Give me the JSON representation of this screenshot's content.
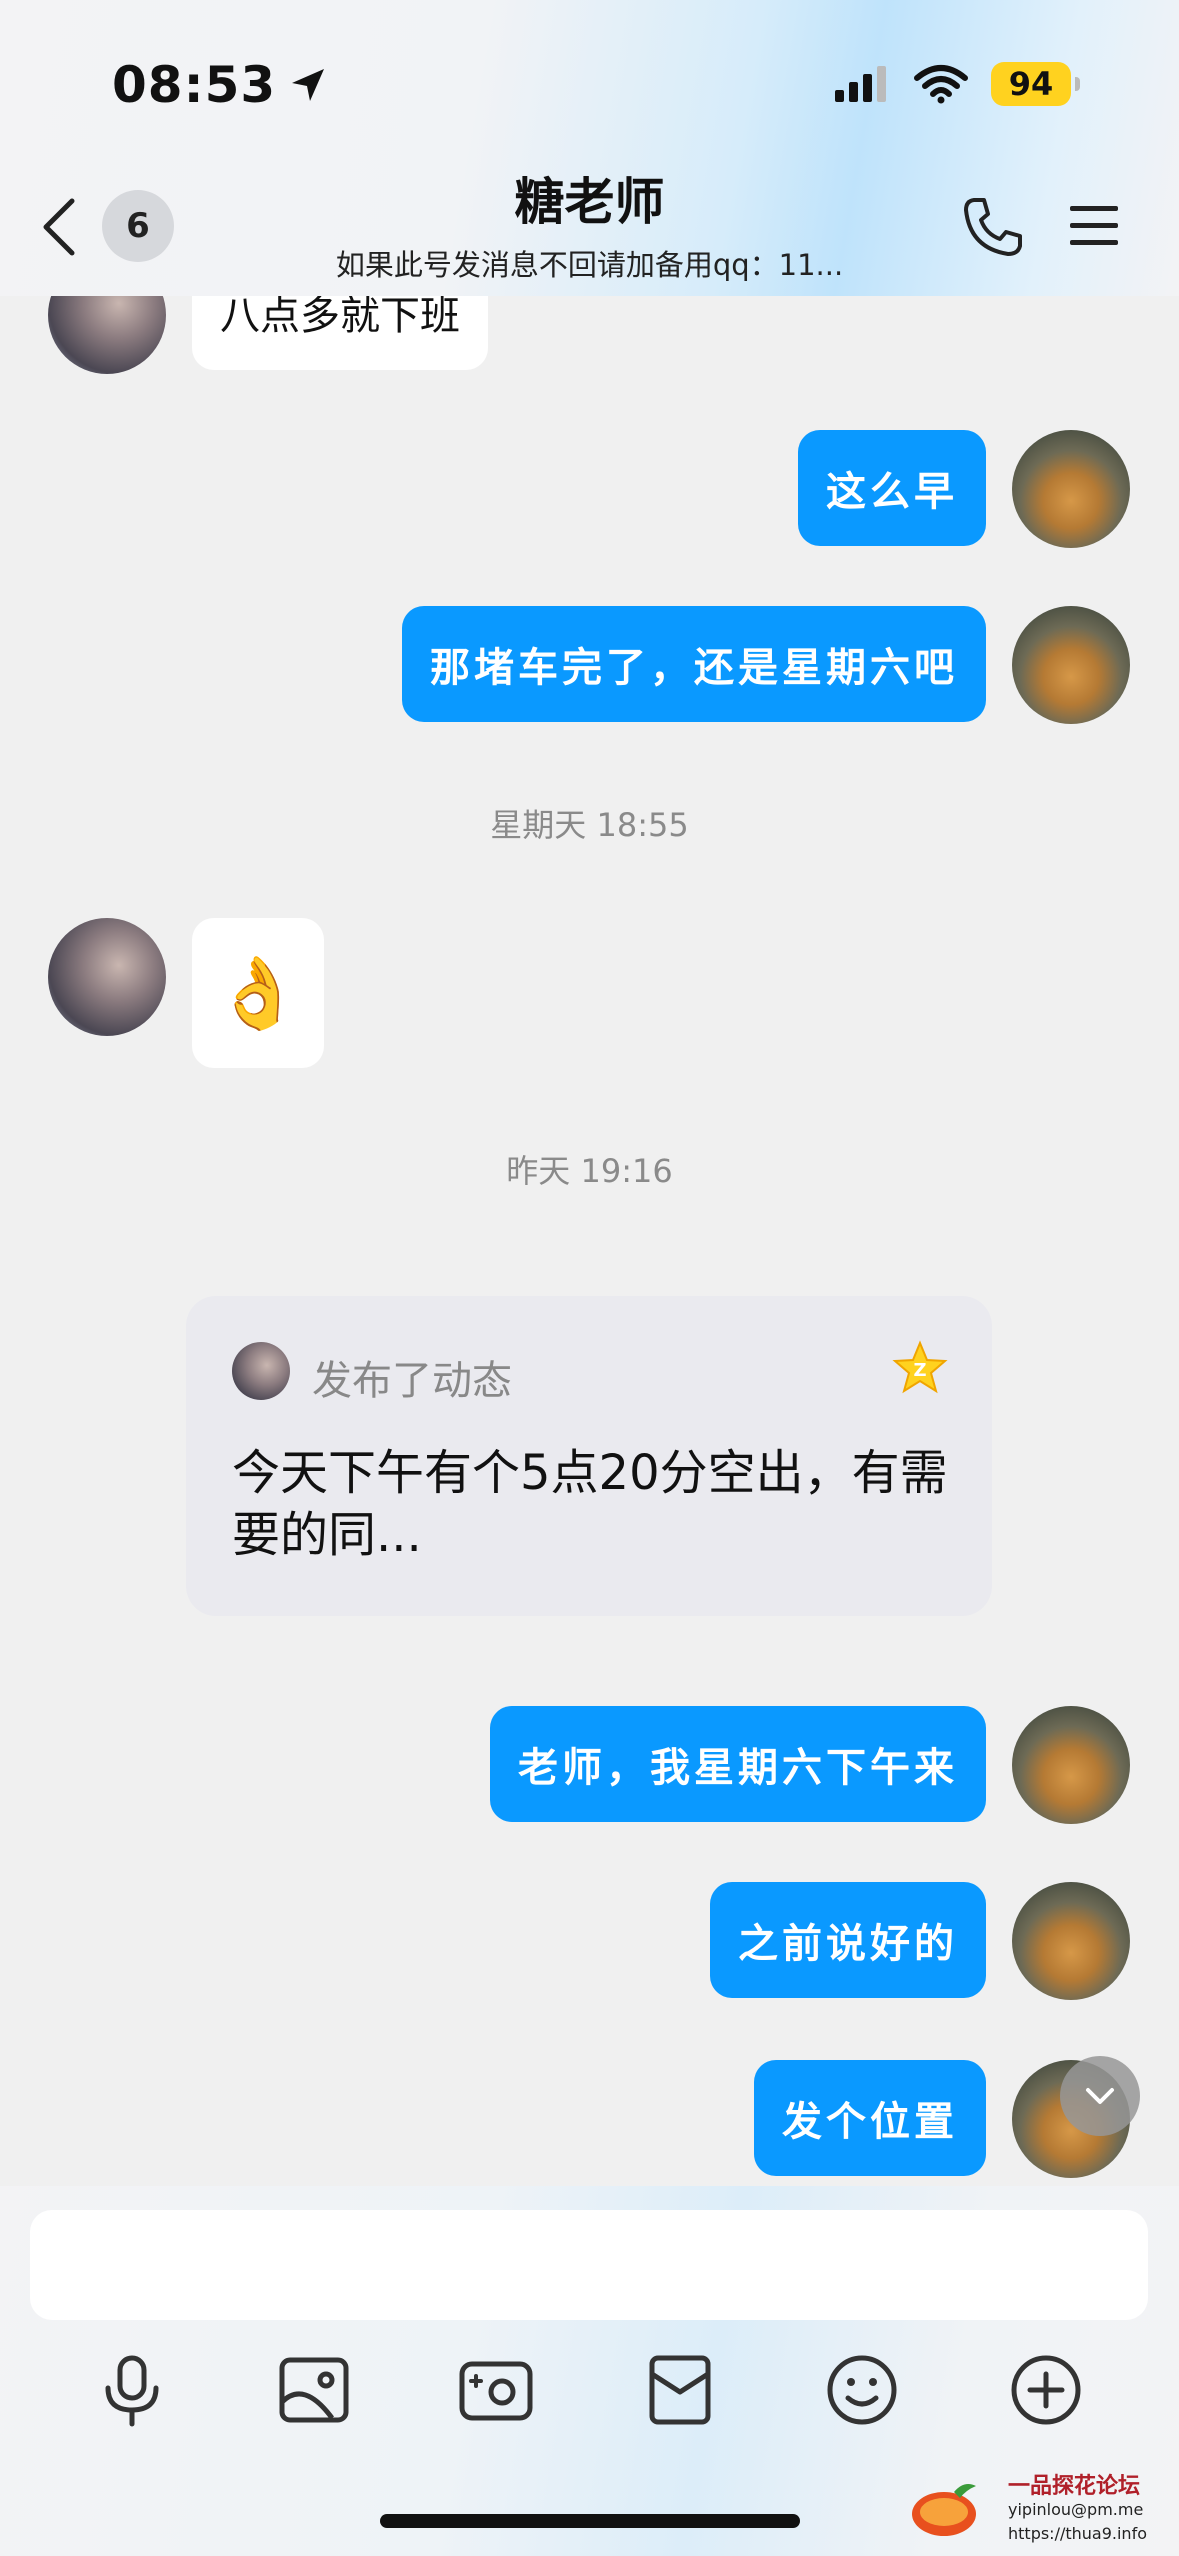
{
  "status_bar": {
    "time": "08:53",
    "battery": "94"
  },
  "header": {
    "unread_count": "6",
    "title": "糖老师",
    "subtitle": "如果此号发消息不回请加备用qq：11..."
  },
  "messages": [
    {
      "side": "in",
      "text": "八点多就下班"
    },
    {
      "side": "out",
      "text": "这么早"
    },
    {
      "side": "out",
      "text": "那堵车完了，还是星期六吧"
    },
    {
      "timestamp": "星期天 18:55"
    },
    {
      "side": "in",
      "emoji": "👌"
    },
    {
      "timestamp": "昨天 19:16"
    },
    {
      "feed": {
        "label": "发布了动态",
        "text": "今天下午有个5点20分空出，有需要的同..."
      }
    },
    {
      "side": "out",
      "text": "老师，我星期六下午来"
    },
    {
      "side": "out",
      "text": "之前说好的"
    },
    {
      "side": "out",
      "text": "发个位置"
    }
  ],
  "input": {
    "placeholder": ""
  },
  "toolbar": [
    "mic-icon",
    "image-icon",
    "camera-icon",
    "red-packet-icon",
    "emoji-icon",
    "plus-icon"
  ],
  "watermark": {
    "title": "一品探花论坛",
    "email": "yipinlou@pm.me",
    "url": "https://thua9.info"
  },
  "colors": {
    "outgoing_bubble": "#0a99ff",
    "incoming_bubble": "#ffffff",
    "chat_background": "#f0f0f0",
    "battery": "#ffd21f"
  }
}
